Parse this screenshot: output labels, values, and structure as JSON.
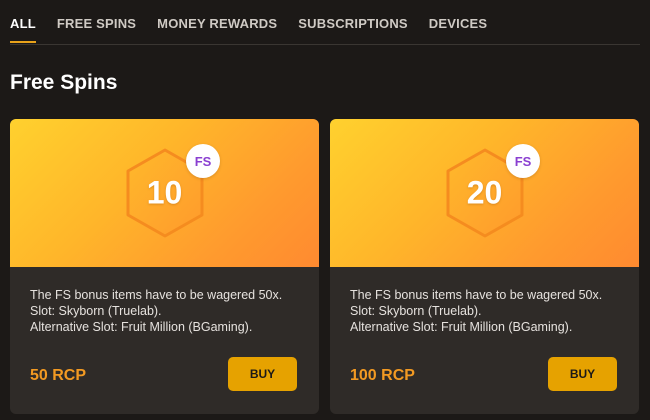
{
  "tabs": [
    {
      "label": "ALL",
      "active": true
    },
    {
      "label": "FREE SPINS",
      "active": false
    },
    {
      "label": "MONEY REWARDS",
      "active": false
    },
    {
      "label": "SUBSCRIPTIONS",
      "active": false
    },
    {
      "label": "DEVICES",
      "active": false
    }
  ],
  "section": {
    "title": "Free Spins"
  },
  "cards": [
    {
      "spins": "10",
      "badge": "FS",
      "description_line1": "The FS bonus items have to be wagered 50x. Slot: Skyborn (Truelab).",
      "description_line2": "Alternative Slot: Fruit Million (BGaming).",
      "price": "50 RCP",
      "buy_label": "BUY"
    },
    {
      "spins": "20",
      "badge": "FS",
      "description_line1": "The FS bonus items have to be wagered 50x. Slot: Skyborn (Truelab).",
      "description_line2": "Alternative Slot: Fruit Million (BGaming).",
      "price": "100 RCP",
      "buy_label": "BUY"
    }
  ],
  "colors": {
    "background": "#1c1917",
    "card_body": "#2f2b28",
    "accent_orange": "#f39a22",
    "button_yellow": "#e6a200",
    "badge_text_purple": "#8a3fd1"
  },
  "icons": {
    "hexagon": "hexagon-icon"
  }
}
